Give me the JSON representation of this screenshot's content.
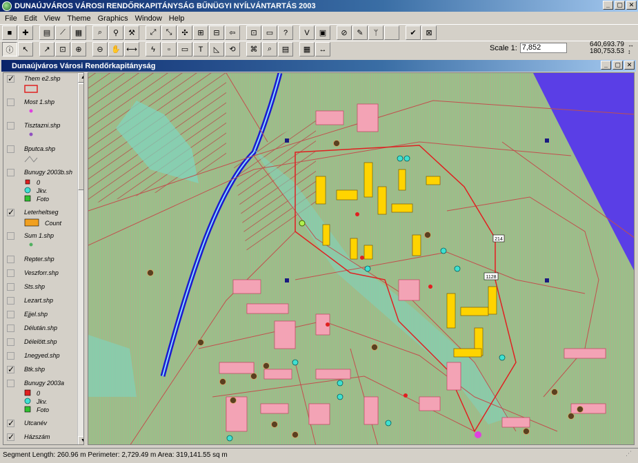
{
  "window": {
    "title": "DUNAÚJVÁROS VÁROSI RENDŐRKAPITÁNYSÁG  BŰNÜGYI NYÍLVÁNTARTÁS 2003"
  },
  "menu": [
    "File",
    "Edit",
    "View",
    "Theme",
    "Graphics",
    "Window",
    "Help"
  ],
  "toolbar1_icons": [
    "save-icon",
    "add-theme-icon",
    "theme-properties-icon",
    "edit-legend-icon",
    "open-table-icon",
    "find-icon",
    "query-icon",
    "hammer-icon",
    "zoom-full-extent-icon",
    "zoom-to-themes-icon",
    "zoom-to-selected-icon",
    "zoom-in-icon",
    "zoom-out-icon",
    "zoom-previous-icon",
    "select-by-theme-icon",
    "clear-selected-icon",
    "help-icon",
    "vertex-icon",
    "snap-icon",
    "no-icon",
    "draw-icon",
    "attr-icon",
    "blank-icon",
    "check-icon",
    "layout-icon"
  ],
  "toolbar2_icons": [
    "identify-icon",
    "pointer-icon",
    "vertex-edit-icon",
    "zoom-select-icon",
    "zoom-in-tool-icon",
    "zoom-out-tool-icon",
    "pan-icon",
    "measure-icon",
    "hotlink-icon",
    "area-of-interest-icon",
    "label-icon",
    "text-icon",
    "draw-shape-icon",
    "spiral-icon",
    "network-icon",
    "locate-icon",
    "table-icon",
    "chart-icon",
    "resize-icon"
  ],
  "scale": {
    "label": "Scale 1:",
    "value": "7,852"
  },
  "coords": {
    "x": "640,693.79",
    "y": "180,753.53"
  },
  "view": {
    "title": "Dunaújváros  Városi Rendőrkapitányság"
  },
  "toc": {
    "themes": [
      {
        "name": "Them e2.shp",
        "checked": true,
        "legend": [
          {
            "label": "",
            "symbol": "red-outline-rect"
          }
        ]
      },
      {
        "name": "Most 1.shp",
        "checked": false,
        "legend": [
          {
            "label": "",
            "symbol": "magenta-dot"
          }
        ]
      },
      {
        "name": "Tisztazni.shp",
        "checked": false,
        "legend": [
          {
            "label": "",
            "symbol": "purple-dot"
          }
        ]
      },
      {
        "name": "Bputca.shp",
        "checked": false,
        "legend": [
          {
            "label": "",
            "symbol": "gray-line"
          }
        ]
      },
      {
        "name": "Bunugy 2003b.sh",
        "checked": false,
        "legend": [
          {
            "label": "0",
            "symbol": "red-square-small"
          },
          {
            "label": "Jkv.",
            "symbol": "cyan-circle"
          },
          {
            "label": "Foto",
            "symbol": "green-square"
          }
        ]
      },
      {
        "name": "Leterheltseg",
        "checked": true,
        "legend": [
          {
            "label": "Count",
            "symbol": "orange-rect"
          }
        ]
      },
      {
        "name": "Sum 1.shp",
        "checked": false,
        "legend": [
          {
            "label": "",
            "symbol": "green-dot"
          }
        ]
      },
      {
        "name": "Repter.shp",
        "checked": false,
        "legend": []
      },
      {
        "name": "Veszforr.shp",
        "checked": false,
        "legend": []
      },
      {
        "name": "Sts.shp",
        "checked": false,
        "legend": []
      },
      {
        "name": "Lezart.shp",
        "checked": false,
        "legend": []
      },
      {
        "name": "Ejjel.shp",
        "checked": false,
        "legend": []
      },
      {
        "name": "Délután.shp",
        "checked": false,
        "legend": []
      },
      {
        "name": "Délelött.shp",
        "checked": false,
        "legend": []
      },
      {
        "name": "1negyed.shp",
        "checked": false,
        "legend": []
      },
      {
        "name": "Btk.shp",
        "checked": true,
        "legend": []
      },
      {
        "name": "Bunugy 2003a",
        "checked": false,
        "legend": [
          {
            "label": "0",
            "symbol": "red-square"
          },
          {
            "label": "Jkv.",
            "symbol": "cyan-circle"
          },
          {
            "label": "Foto",
            "symbol": "green-square"
          }
        ]
      },
      {
        "name": "Utcanév",
        "checked": true,
        "legend": []
      },
      {
        "name": "Házszám",
        "checked": true,
        "legend": []
      }
    ]
  },
  "map": {
    "road_labels": [
      "214",
      "1128"
    ],
    "colors": {
      "background": "#8fc88a",
      "water": "#5a3ee6",
      "canal": "#1a1ad0",
      "building": "#ffd400",
      "outline": "#e02020"
    }
  },
  "status": {
    "text": "Segment Length: 260.96 m  Perimeter: 2,729.49 m  Area: 319,141.55 sq m"
  }
}
